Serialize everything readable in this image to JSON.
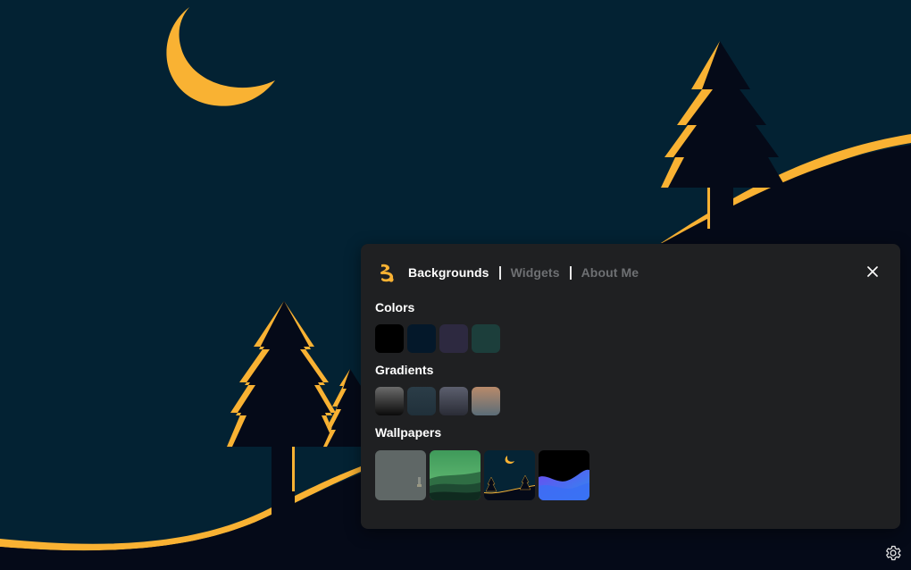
{
  "background": {
    "sky_color": "#032233",
    "accent_color": "#f9b233",
    "hill_color": "#050a18"
  },
  "panel": {
    "tabs": [
      {
        "label": "Backgrounds",
        "active": true
      },
      {
        "label": "Widgets",
        "active": false
      },
      {
        "label": "About Me",
        "active": false
      }
    ],
    "sections": {
      "colors": {
        "title": "Colors",
        "items": [
          "#000000",
          "#04182a",
          "#2d2940",
          "#1c3e3b"
        ]
      },
      "gradients": {
        "title": "Gradients",
        "items": [
          {
            "from": "#6b6b6b",
            "to": "#0a0a0a"
          },
          {
            "from": "#293a45",
            "to": "#22313a"
          },
          {
            "from": "#5a5d6c",
            "to": "#2a2c36"
          },
          {
            "from": "#b88a6a",
            "to": "#5b6d78"
          }
        ]
      },
      "wallpapers": {
        "title": "Wallpapers",
        "items": [
          "gray-misty",
          "green-hills",
          "night-forest",
          "blue-waves"
        ]
      }
    },
    "close_icon": "close-icon"
  },
  "settings_icon": "gear-icon"
}
